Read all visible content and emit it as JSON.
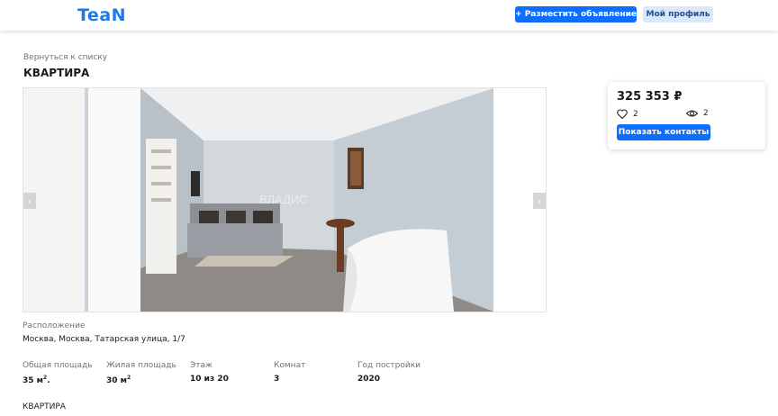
{
  "header": {
    "logo": "TeaN",
    "post_button": "+ Разместить объявление",
    "profile_button": "Мой профиль"
  },
  "listing": {
    "back_link": "Вернуться к списку",
    "title": "КВАРТИРА",
    "photo_watermark": "ВЛАДИС",
    "price": "325 353 ₽",
    "favorites_count": "2",
    "views_count": "2",
    "contacts_button": "Показать контакты",
    "location_label": "Расположение",
    "location_value": "Москва, Москва, Татарская улица, 1/7",
    "specs": [
      {
        "label": "Общая площадь",
        "value": "35 м",
        "suffix": "2",
        "tail": "."
      },
      {
        "label": "Жилая площадь",
        "value": "30 м",
        "suffix": "2",
        "tail": ""
      },
      {
        "label": "Этаж",
        "value": "10 из 20",
        "suffix": "",
        "tail": ""
      },
      {
        "label": "Комнат",
        "value": "3",
        "suffix": "",
        "tail": ""
      },
      {
        "label": "Год постройки",
        "value": "2020",
        "suffix": "",
        "tail": ""
      }
    ],
    "description": "КВАРТИРА"
  },
  "gallery": {
    "prev_arrow": "‹",
    "next_arrow": "›"
  },
  "colors": {
    "brand": "#1e7ae6",
    "primary_button": "#0d6efd",
    "secondary_button": "#dbe7fb"
  }
}
